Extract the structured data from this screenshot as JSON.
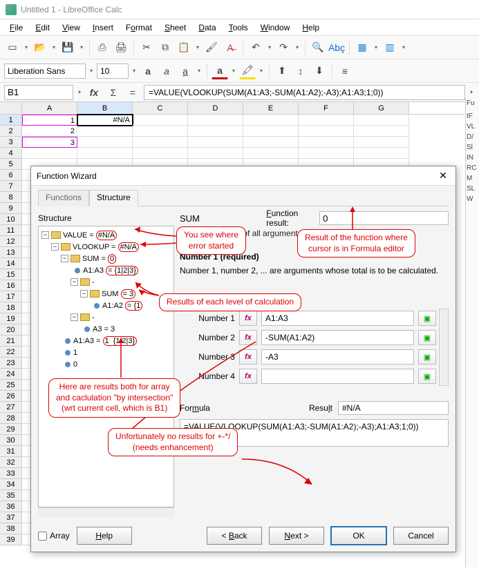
{
  "window": {
    "title": "Untitled 1 - LibreOffice Calc"
  },
  "menu": {
    "file": "File",
    "edit": "Edit",
    "view": "View",
    "insert": "Insert",
    "format": "Format",
    "sheet": "Sheet",
    "data": "Data",
    "tools": "Tools",
    "window": "Window",
    "help": "Help"
  },
  "format_toolbar": {
    "font_name": "Liberation Sans",
    "font_size": "10"
  },
  "formula_bar": {
    "cell_ref": "B1",
    "formula": "=VALUE(VLOOKUP(SUM(A1:A3;-SUM(A1:A2);-A3);A1:A3;1;0))"
  },
  "sheet": {
    "columns": [
      "A",
      "B",
      "C",
      "D",
      "E",
      "F",
      "G"
    ],
    "cells": {
      "A1": "1",
      "A2": "2",
      "A3": "3",
      "B1": "#N/A"
    },
    "row_count": 39
  },
  "dialog": {
    "title": "Function Wizard",
    "tabs": {
      "functions": "Functions",
      "structure": "Structure"
    },
    "structure_label": "Structure",
    "right": {
      "fn_name": "SUM",
      "function_result_label": "Function result:",
      "function_result_value": "0",
      "description": "Returns the sum of all arguments.",
      "number1_label": "Number 1 (required)",
      "number_hint": "Number 1, number 2, ... are arguments whose total is to be calculated.",
      "args": [
        {
          "label": "Number 1",
          "value": "A1:A3"
        },
        {
          "label": "Number 2",
          "value": "-SUM(A1:A2)"
        },
        {
          "label": "Number 3",
          "value": "-A3"
        },
        {
          "label": "Number 4",
          "value": ""
        }
      ],
      "formula_label": "Formula",
      "result_label": "Result",
      "result_value": "#N/A",
      "formula_text": "=VALUE(VLOOKUP(SUM(A1:A3;-SUM(A1:A2);-A3);A1:A3;1;0))"
    },
    "tree": {
      "n0": "VALUE = #N/A",
      "n1": "VLOOKUP = #N/A",
      "n2": "SUM = 0",
      "n3": "A1:A3 = {1|2|3}",
      "n4": "-",
      "n5": "SUM = 3",
      "n6": "A1:A2 = {1",
      "n7": "-",
      "n8": "A3 = 3",
      "n9": "A1:A3 = 1  {1|2|3}",
      "n10": "1",
      "n11": "0"
    },
    "buttons": {
      "array": "Array",
      "help": "Help",
      "back": "< Back",
      "next": "Next >",
      "ok": "OK",
      "cancel": "Cancel"
    }
  },
  "callouts": {
    "c1": "You see where\nerror started",
    "c2": "Result of the function where\ncursor is in Formula editor",
    "c3": "Results of each level of calculation",
    "c4": "Here are results both for array\nand caclulation \"by intersection\"\n(wrt current cell, which is B1)",
    "c5": "Unfortunately no results for +-*/\n(needs enhancement)"
  },
  "sidebar_items": [
    "Fu",
    "",
    "IF",
    "VL",
    "D/",
    "Sl",
    "IN",
    "RC",
    "M",
    "SL",
    "W"
  ]
}
